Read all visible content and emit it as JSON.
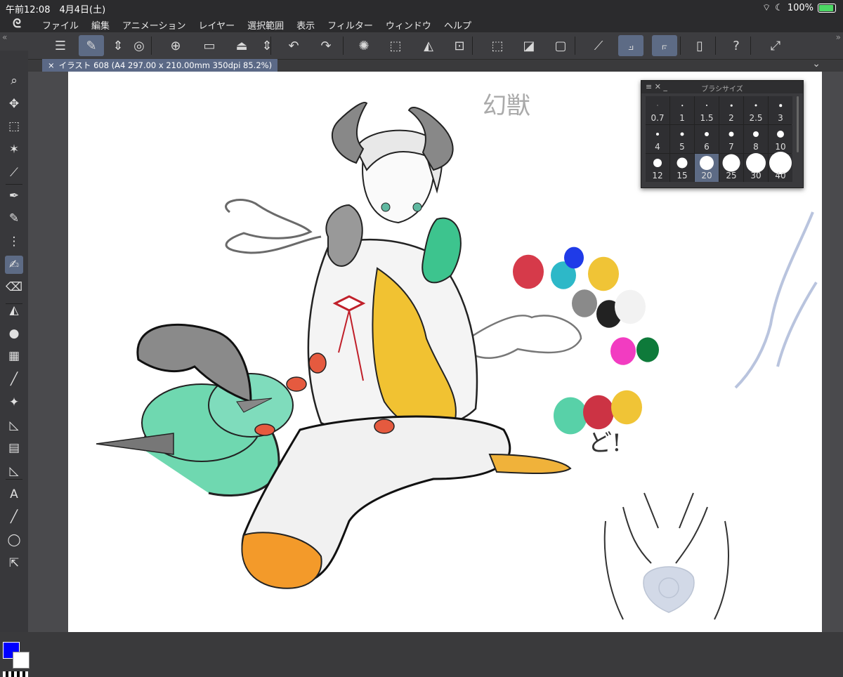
{
  "status": {
    "time": "午前12:08　4月4日(土)",
    "battery": "100%",
    "battery_level": 1.0
  },
  "menu": {
    "logo": "ᘓ",
    "items": [
      "ファイル",
      "編集",
      "アニメーション",
      "レイヤー",
      "選択範囲",
      "表示",
      "フィルター",
      "ウィンドウ",
      "ヘルプ"
    ]
  },
  "edges": {
    "left": "«",
    "right": "»"
  },
  "toolbar": {
    "icons": [
      "menu-icon",
      "brush-tool-icon",
      "updown-icon",
      "spiral-icon",
      "new-file-icon",
      "open-folder-icon",
      "save-icon",
      "updown-icon",
      "undo-icon",
      "redo-icon",
      "loading-icon",
      "select-icon",
      "fill-icon",
      "transform-icon",
      "deselect-icon",
      "invert-icon",
      "border-icon",
      "snap-icon",
      "ruler-icon",
      "ruler-2-icon",
      "phone-icon",
      "help-icon",
      "fullscreen-icon"
    ]
  },
  "tab": {
    "title": "イラスト 608 (A4 297.00 x 210.00mm 350dpi 85.2%)",
    "close": "×",
    "chevron": "⌄"
  },
  "tools": [
    "zoom-icon",
    "move-icon",
    "marquee-icon",
    "wand-icon",
    "eyedropper-icon",
    "pen-icon",
    "pencil-icon",
    "airbrush-icon",
    "brush-icon",
    "eraser-icon",
    "fill-icon",
    "blend-icon",
    "gradient-icon",
    "line-icon",
    "decoration-icon",
    "frame-icon",
    "layout-icon",
    "ruler-icon",
    "text-icon",
    "straight-line-icon",
    "lasso-icon",
    "select-arrow-icon"
  ],
  "colors": {
    "main": "#0000ff",
    "sub": "#ffffff",
    "accent": "#5d6b85"
  },
  "brush_panel": {
    "title": "ブラシサイズ",
    "controls": "≡ ✕ _",
    "sizes": [
      {
        "label": "0.7",
        "d": 1
      },
      {
        "label": "1",
        "d": 1.5
      },
      {
        "label": "1.5",
        "d": 2
      },
      {
        "label": "2",
        "d": 2.5
      },
      {
        "label": "2.5",
        "d": 3
      },
      {
        "label": "3",
        "d": 3.5
      },
      {
        "label": "4",
        "d": 4
      },
      {
        "label": "5",
        "d": 5
      },
      {
        "label": "6",
        "d": 6
      },
      {
        "label": "7",
        "d": 7
      },
      {
        "label": "8",
        "d": 8
      },
      {
        "label": "10",
        "d": 10
      },
      {
        "label": "12",
        "d": 12
      },
      {
        "label": "15",
        "d": 15
      },
      {
        "label": "20",
        "d": 20
      },
      {
        "label": "25",
        "d": 25
      },
      {
        "label": "30",
        "d": 28
      },
      {
        "label": "40",
        "d": 32
      }
    ],
    "selected": "20"
  },
  "canvas": {
    "handwriting": "幻獣",
    "handwriting2": "ど!",
    "palette": [
      "#d63a4a",
      "#2db8c8",
      "#1f3be8",
      "#f0c436",
      "#8a8a8a",
      "#222222",
      "#f2f2f2",
      "#f23cc1",
      "#0e7a3a",
      "#58d1a8",
      "#cc3344",
      "#f0c436"
    ]
  }
}
